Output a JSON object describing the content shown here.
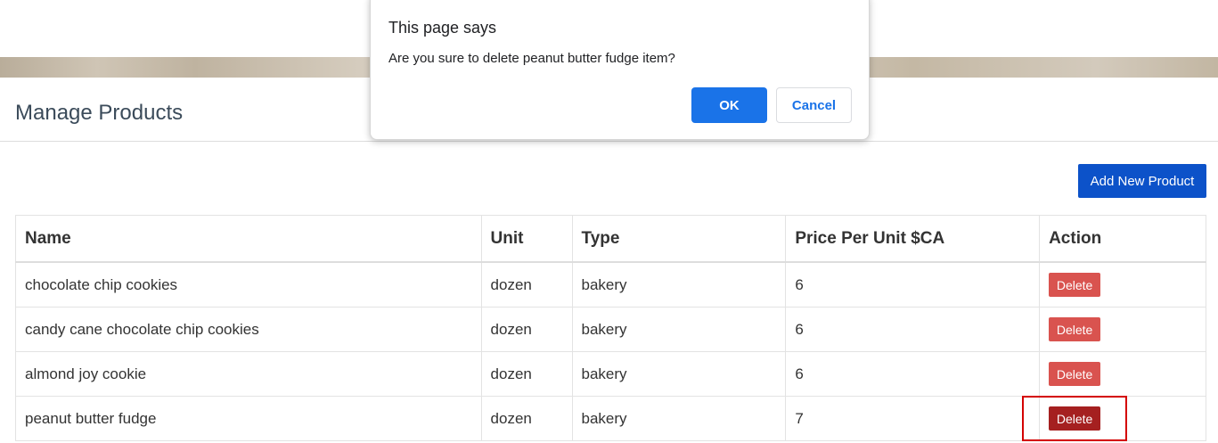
{
  "header": {
    "title": "Manage Products"
  },
  "toolbar": {
    "add_label": "Add New Product"
  },
  "table": {
    "headers": [
      "Name",
      "Unit",
      "Type",
      "Price Per Unit $CA",
      "Action"
    ],
    "rows": [
      {
        "name": "chocolate chip cookies",
        "unit": "dozen",
        "type": "bakery",
        "price": "6",
        "action": "Delete"
      },
      {
        "name": "candy cane chocolate chip cookies",
        "unit": "dozen",
        "type": "bakery",
        "price": "6",
        "action": "Delete"
      },
      {
        "name": "almond joy cookie",
        "unit": "dozen",
        "type": "bakery",
        "price": "6",
        "action": "Delete"
      },
      {
        "name": "peanut butter fudge",
        "unit": "dozen",
        "type": "bakery",
        "price": "7",
        "action": "Delete"
      }
    ]
  },
  "dialog": {
    "title": "This page says",
    "message": "Are you sure to delete peanut butter fudge item?",
    "ok_label": "OK",
    "cancel_label": "Cancel"
  },
  "colors": {
    "primary": "#0c52c9",
    "danger": "#d9534f",
    "danger_active": "#a52020",
    "dialog_ok": "#1a73e8",
    "highlight": "#d40000"
  }
}
